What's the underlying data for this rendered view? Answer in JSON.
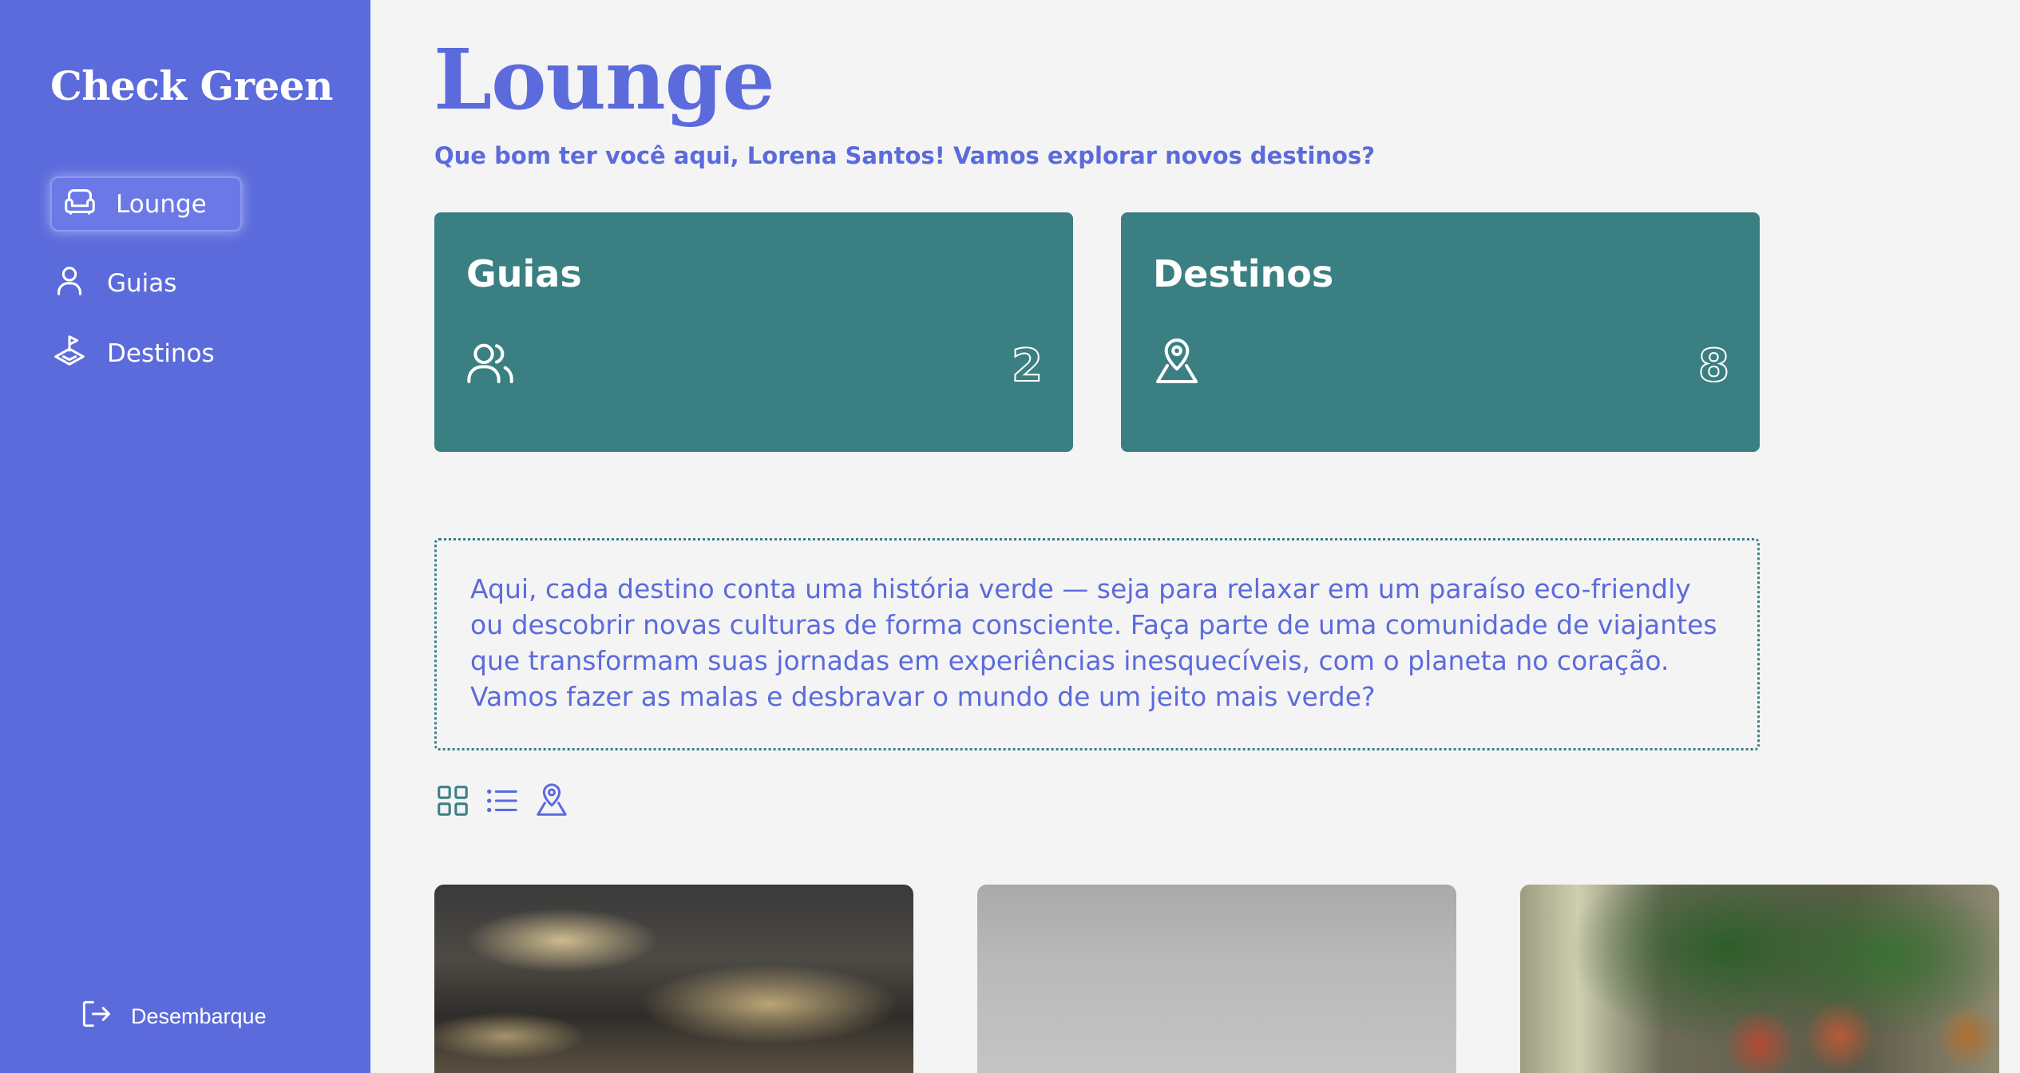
{
  "sidebar": {
    "brand": "Check Green",
    "items": [
      {
        "label": "Lounge",
        "icon": "sofa-icon",
        "active": true
      },
      {
        "label": "Guias",
        "icon": "user-icon",
        "active": false
      },
      {
        "label": "Destinos",
        "icon": "map-flag-icon",
        "active": false
      }
    ],
    "logout": {
      "label": "Desembarque",
      "icon": "logout-icon"
    }
  },
  "main": {
    "title": "Lounge",
    "subtitle": "Que bom ter você aqui, Lorena Santos! Vamos explorar novos destinos?",
    "cards": [
      {
        "title": "Guias",
        "icon": "users-icon",
        "count": "2"
      },
      {
        "title": "Destinos",
        "icon": "map-pin-icon",
        "count": "8"
      }
    ],
    "intro": "Aqui, cada destino conta uma história verde — seja para relaxar em um paraíso eco-friendly ou descobrir novas culturas de forma consciente. Faça parte de uma comunidade de viajantes que transformam suas jornadas em experiências inesquecíveis, com o planeta no coração. Vamos fazer as malas e desbravar o mundo de um jeito mais verde?",
    "view_toggles": [
      "grid-icon",
      "list-icon",
      "map-pin-icon"
    ]
  },
  "colors": {
    "sidebar": "#5b6bdc",
    "accent": "#5b6bdc",
    "card": "#3a7f82",
    "background": "#f4f4f4"
  }
}
